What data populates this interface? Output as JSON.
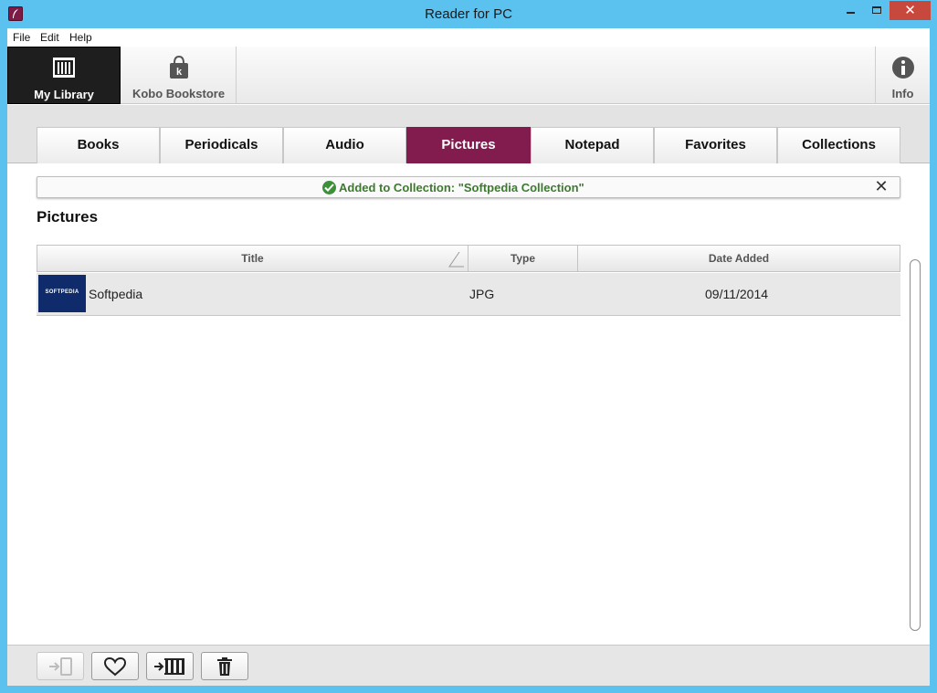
{
  "window": {
    "title": "Reader for PC",
    "close_glyph": "✕"
  },
  "menu": {
    "items": [
      {
        "label": "File"
      },
      {
        "label": "Edit"
      },
      {
        "label": "Help"
      }
    ]
  },
  "nav": {
    "library": {
      "label": "My Library",
      "icon": "bookshelf-icon"
    },
    "bookstore": {
      "label": "Kobo Bookstore",
      "icon": "shopping-bag-icon",
      "bag_letter": "k"
    },
    "info": {
      "label": "Info",
      "icon": "info-icon"
    }
  },
  "tabs": [
    {
      "label": "Books",
      "active": false
    },
    {
      "label": "Periodicals",
      "active": false
    },
    {
      "label": "Audio",
      "active": false
    },
    {
      "label": "Pictures",
      "active": true
    },
    {
      "label": "Notepad",
      "active": false
    },
    {
      "label": "Favorites",
      "active": false
    },
    {
      "label": "Collections",
      "active": false
    }
  ],
  "notification": {
    "text": "Added to Collection: \"Softpedia Collection\"",
    "close_glyph": "✕"
  },
  "section": {
    "title": "Pictures"
  },
  "table": {
    "columns": {
      "title": "Title",
      "type": "Type",
      "date": "Date Added"
    },
    "rows": [
      {
        "thumbnail_text": "SOFTPEDIA",
        "title": "Softpedia",
        "type": "JPG",
        "date": "09/11/2014"
      }
    ]
  },
  "toolbar": {
    "buttons": [
      {
        "name": "send-to-device-button",
        "icon": "send-to-device-icon",
        "enabled": false
      },
      {
        "name": "favorite-button",
        "icon": "heart-icon",
        "enabled": true
      },
      {
        "name": "add-to-collection-button",
        "icon": "add-to-shelf-icon",
        "enabled": true
      },
      {
        "name": "delete-button",
        "icon": "trash-icon",
        "enabled": true
      }
    ]
  },
  "colors": {
    "titlebar": "#5bc2ef",
    "accent": "#821c4e",
    "notice_text": "#3d7a2f",
    "close_button": "#c7483d"
  }
}
